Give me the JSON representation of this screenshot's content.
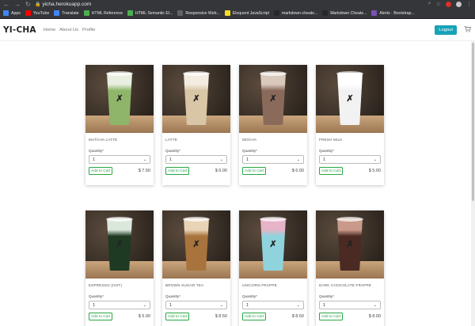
{
  "browser": {
    "url": "yicha.herokuapp.com",
    "bookmarks": [
      {
        "label": "Apps",
        "icon": "apps-grid-icon",
        "color": "#4285f4"
      },
      {
        "label": "YouTube",
        "icon": "youtube-icon",
        "color": "#ff0000"
      },
      {
        "label": "Translate",
        "icon": "translate-icon",
        "color": "#4285f4"
      },
      {
        "label": "HTML Reference",
        "icon": "html-ref-icon",
        "color": "#4caf50"
      },
      {
        "label": "HTML Semantic El...",
        "icon": "html-semantic-icon",
        "color": "#4caf50"
      },
      {
        "label": "Responsive Web...",
        "icon": "code-icon",
        "color": "#5f6368"
      },
      {
        "label": "Eloquent JavaScript",
        "icon": "js-book-icon",
        "color": "#f7df1e"
      },
      {
        "label": "markdown-cheats...",
        "icon": "github-icon",
        "color": "#24292e"
      },
      {
        "label": "Markdown Cheats...",
        "icon": "github-icon",
        "color": "#24292e"
      },
      {
        "label": "Alerts · Bootstrap...",
        "icon": "bootstrap-icon",
        "color": "#7952b3"
      }
    ]
  },
  "nav": {
    "brand": "YI-CHA",
    "links": [
      "Home",
      "About Us",
      "Profile"
    ],
    "logout": "Logout",
    "cart_icon": "cart-icon"
  },
  "products": [
    {
      "name": "MATCHA LATTE",
      "quantity_label": "Quantity*",
      "quantity": "1",
      "add_label": "Add to Cart",
      "price": "$ 7.50",
      "drink_color": "#8fb56a",
      "top_color": "#e8efe0"
    },
    {
      "name": "LATTE",
      "quantity_label": "Quantity*",
      "quantity": "1",
      "add_label": "Add to Cart",
      "price": "$ 6.00",
      "drink_color": "#d8c6a6",
      "top_color": "#f3ece0"
    },
    {
      "name": "MOCHA",
      "quantity_label": "Quantity*",
      "quantity": "1",
      "add_label": "Add to Cart",
      "price": "$ 6.00",
      "drink_color": "#8a6a5a",
      "top_color": "#d9c9bd"
    },
    {
      "name": "FRESH MILK",
      "quantity_label": "Quantity*",
      "quantity": "1",
      "add_label": "Add to Cart",
      "price": "$ 5.00",
      "drink_color": "#f2f2f2",
      "top_color": "#ffffff"
    },
    {
      "name": "ESPRESSO (HOT)",
      "quantity_label": "Quantity*",
      "quantity": "1",
      "add_label": "Add to Cart",
      "price": "$ 5.00",
      "drink_color": "#1f3a22",
      "top_color": "#dce7dc"
    },
    {
      "name": "BROWN SUGAR TEA",
      "quantity_label": "Quantity*",
      "quantity": "1",
      "add_label": "Add to Cart",
      "price": "$ 8.50",
      "drink_color": "#a8733c",
      "top_color": "#e8d4b7"
    },
    {
      "name": "UNICORN FRAPPE",
      "quantity_label": "Quantity*",
      "quantity": "1",
      "add_label": "Add to Cart",
      "price": "$ 8.50",
      "drink_color": "#8fd3dd",
      "top_color": "#e6b3c7"
    },
    {
      "name": "DARK CHOCOLATE FRAPPE",
      "quantity_label": "Quantity*",
      "quantity": "1",
      "add_label": "Add to Cart",
      "price": "$ 8.00",
      "drink_color": "#4a2a22",
      "top_color": "#c99a8b"
    }
  ]
}
